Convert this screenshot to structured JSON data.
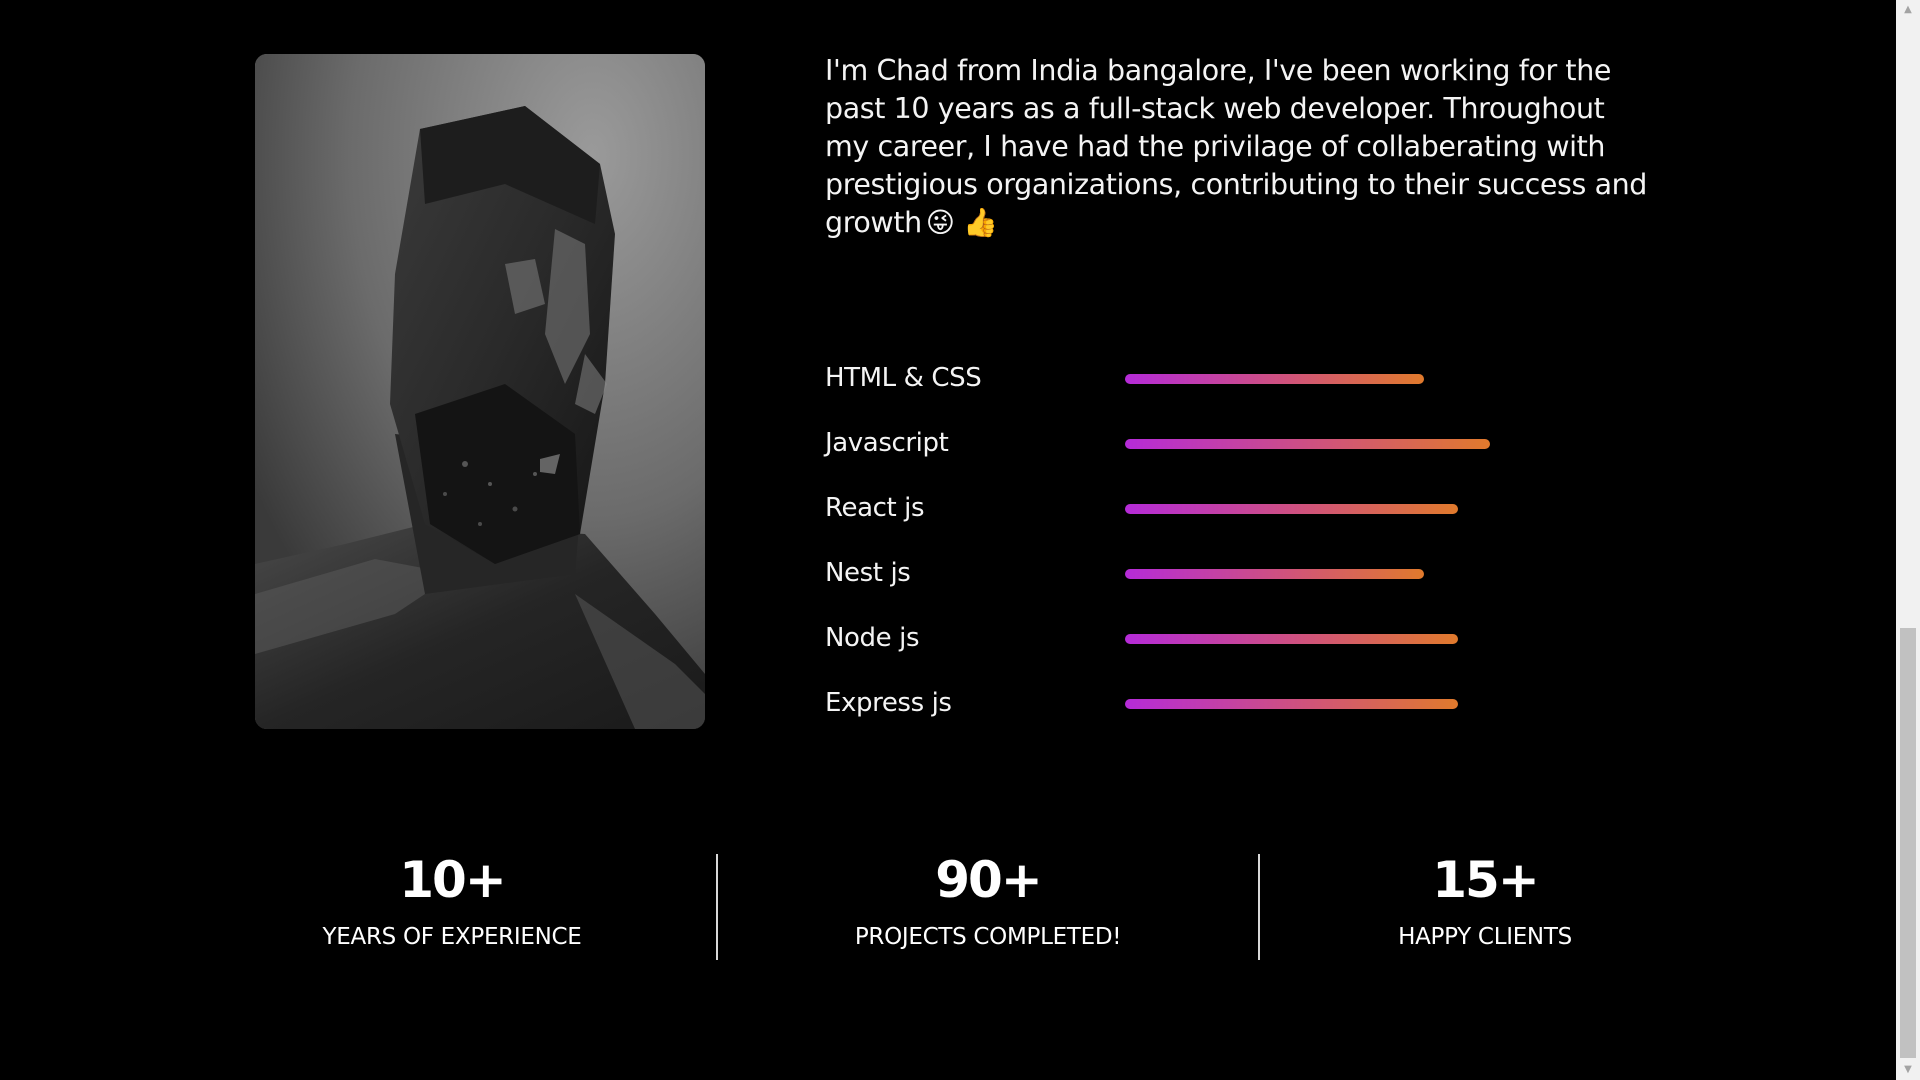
{
  "about": {
    "bio_text": "I'm Chad from India bangalore, I've been working for the past 10 years as a full-stack web developer. Throughout my career, I have had the privilage of collaberating with prestigious organizations, contributing to their success and growth",
    "bio_emojis": "😜 👍"
  },
  "portrait": {
    "icon": "profile-photo"
  },
  "skills": [
    {
      "label": "HTML & CSS",
      "level": 0.665
    },
    {
      "label": "Javascript",
      "level": 0.81
    },
    {
      "label": "React js",
      "level": 0.74
    },
    {
      "label": "Nest js",
      "level": 0.665
    },
    {
      "label": "Node js",
      "level": 0.74
    },
    {
      "label": "Express js",
      "level": 0.74
    }
  ],
  "stats": [
    {
      "value": "10+",
      "label": "YEARS OF EXPERIENCE"
    },
    {
      "value": "90+",
      "label": "PROJECTS COMPLETED!"
    },
    {
      "value": "15+",
      "label": "HAPPY CLIENTS"
    }
  ],
  "colors": {
    "background": "#000000",
    "bar_start": "#b52bd8",
    "bar_end": "#e07a2c",
    "text": "#ffffff"
  }
}
